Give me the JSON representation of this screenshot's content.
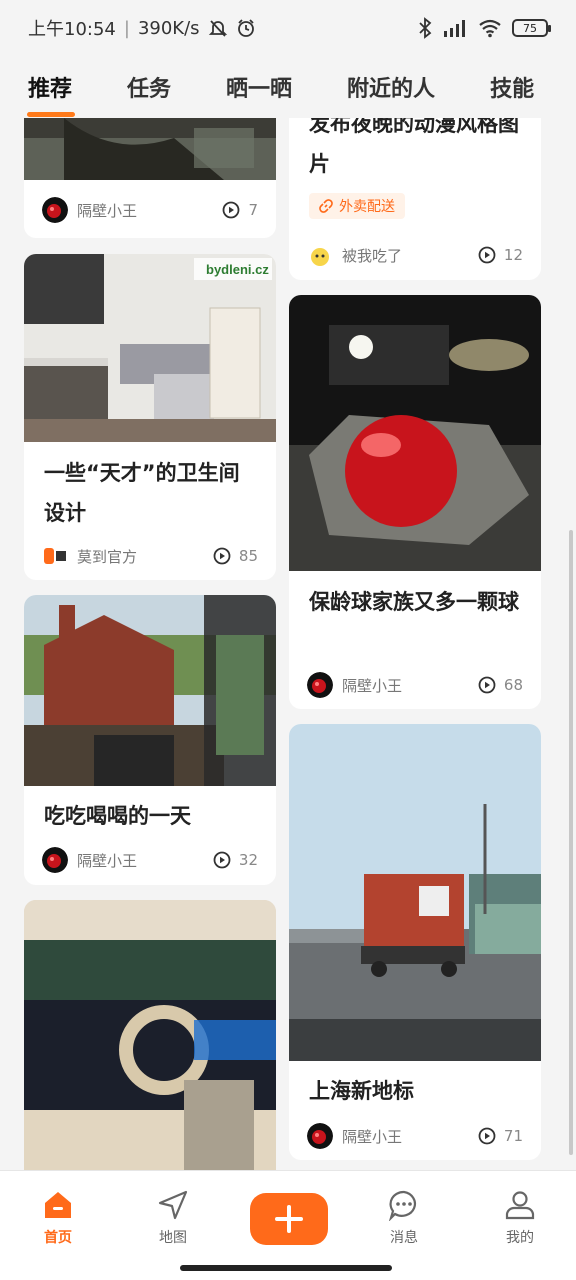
{
  "status_bar": {
    "time": "上午10:54",
    "net_speed": "390K/s",
    "battery": "75"
  },
  "tabs": [
    {
      "label": "推荐",
      "active": true
    },
    {
      "label": "任务"
    },
    {
      "label": "晒一晒"
    },
    {
      "label": "附近的人"
    },
    {
      "label": "技能"
    }
  ],
  "feed": {
    "left": [
      {
        "author": "隔壁小王",
        "views": "7"
      },
      {
        "title": "一些“天才”的卫生间设计",
        "author": "莫到官方",
        "views": "85",
        "image_text": "bydleni.cz"
      },
      {
        "title": "吃吃喝喝的一天",
        "author": "隔壁小王",
        "views": "32"
      },
      {}
    ],
    "right": [
      {
        "title": "发布夜晚的动漫风格图片",
        "tag": "外卖配送",
        "author": "被我吃了",
        "views": "12"
      },
      {
        "title": "保龄球家族又多一颗球",
        "author": "隔壁小王",
        "views": "68"
      },
      {
        "title": "上海新地标",
        "author": "隔壁小王",
        "views": "71"
      }
    ]
  },
  "bottom_nav": {
    "home": "首页",
    "map": "地图",
    "messages": "消息",
    "me": "我的"
  },
  "colors": {
    "accent": "#ff6a1a",
    "background": "#f4f4f4"
  }
}
